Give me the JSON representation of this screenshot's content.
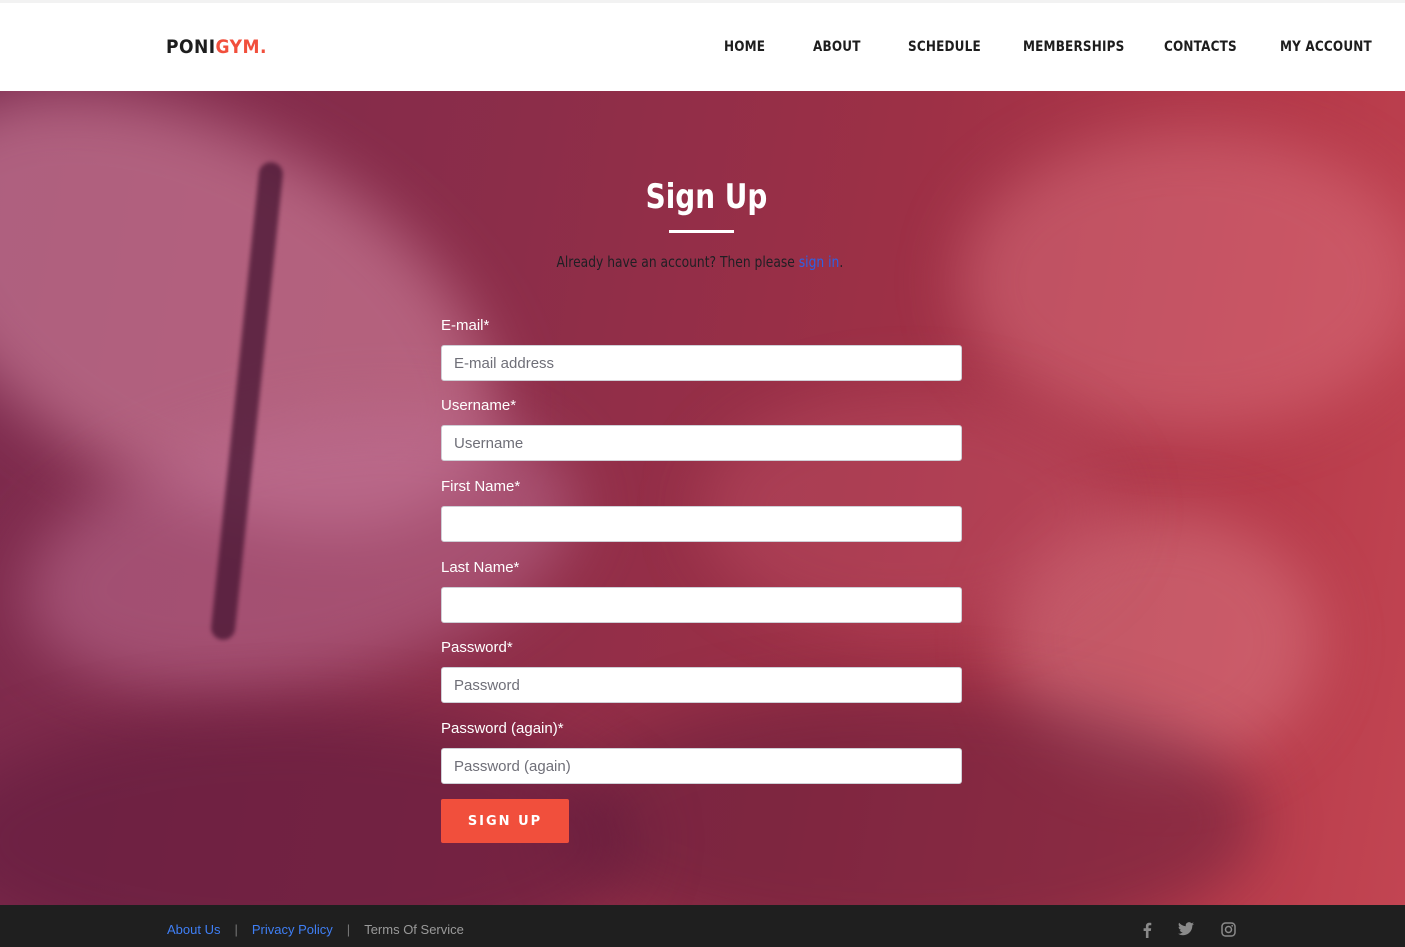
{
  "header": {
    "logo": {
      "part1": "PONI",
      "part2": "GYM."
    },
    "nav": [
      "HOME",
      "ABOUT",
      "SCHEDULE",
      "MEMBERSHIPS",
      "CONTACTS",
      "MY ACCOUNT"
    ]
  },
  "main": {
    "title": "Sign Up",
    "subtitle_prefix": "Already have an account? Then please ",
    "subtitle_link": "sign in",
    "subtitle_suffix": ".",
    "fields": [
      {
        "label": "E-mail*",
        "placeholder": "E-mail address",
        "value": ""
      },
      {
        "label": "Username*",
        "placeholder": "Username",
        "value": ""
      },
      {
        "label": "First Name*",
        "placeholder": "",
        "value": ""
      },
      {
        "label": "Last Name*",
        "placeholder": "",
        "value": ""
      },
      {
        "label": "Password*",
        "placeholder": "Password",
        "value": ""
      },
      {
        "label": "Password (again)*",
        "placeholder": "Password (again)",
        "value": ""
      }
    ],
    "submit_label": "SIGN UP"
  },
  "footer": {
    "links": [
      "About Us",
      "Privacy Policy",
      "Terms Of Service"
    ],
    "separator": "|",
    "social_icons": [
      "facebook-icon",
      "twitter-icon",
      "instagram-icon"
    ]
  },
  "colors": {
    "accent": "#f14f3c",
    "link": "#2d62e6",
    "footer_bg": "#1f1f1f"
  }
}
